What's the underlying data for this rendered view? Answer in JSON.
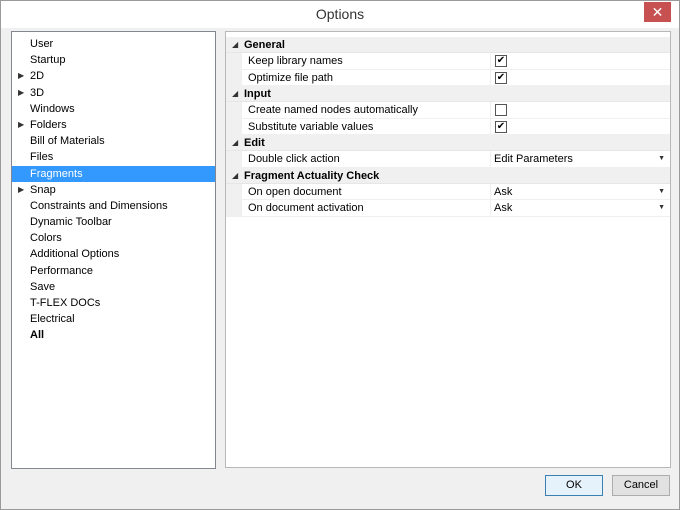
{
  "window": {
    "title": "Options",
    "close_glyph": "✕"
  },
  "tree": {
    "items": [
      {
        "label": "User",
        "expandable": false,
        "selected": false,
        "bold": false
      },
      {
        "label": "Startup",
        "expandable": false,
        "selected": false,
        "bold": false
      },
      {
        "label": "2D",
        "expandable": true,
        "selected": false,
        "bold": false
      },
      {
        "label": "3D",
        "expandable": true,
        "selected": false,
        "bold": false
      },
      {
        "label": "Windows",
        "expandable": false,
        "selected": false,
        "bold": false
      },
      {
        "label": "Folders",
        "expandable": true,
        "selected": false,
        "bold": false
      },
      {
        "label": "Bill of Materials",
        "expandable": false,
        "selected": false,
        "bold": false
      },
      {
        "label": "Files",
        "expandable": false,
        "selected": false,
        "bold": false
      },
      {
        "label": "Fragments",
        "expandable": false,
        "selected": true,
        "bold": false
      },
      {
        "label": "Snap",
        "expandable": true,
        "selected": false,
        "bold": false
      },
      {
        "label": "Constraints and Dimensions",
        "expandable": false,
        "selected": false,
        "bold": false
      },
      {
        "label": "Dynamic Toolbar",
        "expandable": false,
        "selected": false,
        "bold": false
      },
      {
        "label": "Colors",
        "expandable": false,
        "selected": false,
        "bold": false
      },
      {
        "label": "Additional Options",
        "expandable": false,
        "selected": false,
        "bold": false
      },
      {
        "label": "Performance",
        "expandable": false,
        "selected": false,
        "bold": false
      },
      {
        "label": "Save",
        "expandable": false,
        "selected": false,
        "bold": false
      },
      {
        "label": "T-FLEX DOCs",
        "expandable": false,
        "selected": false,
        "bold": false
      },
      {
        "label": "Electrical",
        "expandable": false,
        "selected": false,
        "bold": false
      },
      {
        "label": "All",
        "expandable": false,
        "selected": false,
        "bold": true
      }
    ]
  },
  "groups": [
    {
      "label": "General",
      "rows": [
        {
          "label": "Keep library names",
          "type": "checkbox",
          "checked": true
        },
        {
          "label": "Optimize file path",
          "type": "checkbox",
          "checked": true
        }
      ]
    },
    {
      "label": "Input",
      "rows": [
        {
          "label": "Create named nodes automatically",
          "type": "checkbox",
          "checked": false
        },
        {
          "label": "Substitute variable values",
          "type": "checkbox",
          "checked": true
        }
      ]
    },
    {
      "label": "Edit",
      "rows": [
        {
          "label": "Double click action",
          "type": "dropdown",
          "value": "Edit Parameters"
        }
      ]
    },
    {
      "label": "Fragment Actuality Check",
      "rows": [
        {
          "label": "On open document",
          "type": "dropdown",
          "value": "Ask"
        },
        {
          "label": "On document activation",
          "type": "dropdown",
          "value": "Ask"
        }
      ]
    }
  ],
  "buttons": {
    "ok": "OK",
    "cancel": "Cancel"
  },
  "icons": {
    "expand": "▶",
    "collapse": "◢",
    "dropdown": "▼",
    "check": "✔"
  }
}
